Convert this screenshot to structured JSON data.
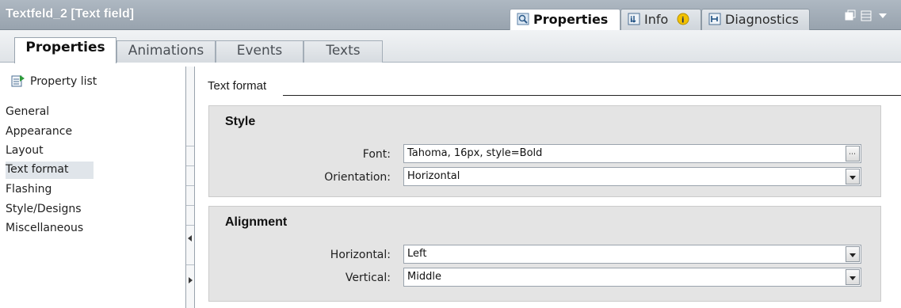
{
  "window": {
    "title": "Textfeld_2 [Text field]"
  },
  "inspector_tabs": [
    {
      "label": "Properties",
      "active": true,
      "icon": "properties-icon"
    },
    {
      "label": "Info",
      "active": false,
      "icon": "info-icon",
      "badge_icon": "info-badge-icon"
    },
    {
      "label": "Diagnostics",
      "active": false,
      "icon": "diagnostics-icon"
    }
  ],
  "tabs": [
    {
      "label": "Properties",
      "active": true
    },
    {
      "label": "Animations",
      "active": false
    },
    {
      "label": "Events",
      "active": false
    },
    {
      "label": "Texts",
      "active": false
    }
  ],
  "sidebar": {
    "property_list_label": "Property list",
    "items": [
      {
        "label": "General",
        "selected": false
      },
      {
        "label": "Appearance",
        "selected": false
      },
      {
        "label": "Layout",
        "selected": false
      },
      {
        "label": "Text format",
        "selected": true
      },
      {
        "label": "Flashing",
        "selected": false
      },
      {
        "label": "Style/Designs",
        "selected": false
      },
      {
        "label": "Miscellaneous",
        "selected": false
      }
    ]
  },
  "main": {
    "section_title": "Text format",
    "style_group": {
      "title": "Style",
      "font_label": "Font:",
      "font_value": "Tahoma, 16px, style=Bold",
      "orientation_label": "Orientation:",
      "orientation_value": "Horizontal"
    },
    "alignment_group": {
      "title": "Alignment",
      "horizontal_label": "Horizontal:",
      "horizontal_value": "Left",
      "vertical_label": "Vertical:",
      "vertical_value": "Middle"
    }
  },
  "colors": {
    "titlebar": "#98a3ae",
    "group_background": "#e4e4e4",
    "selected_nav": "#e0e5ea"
  }
}
